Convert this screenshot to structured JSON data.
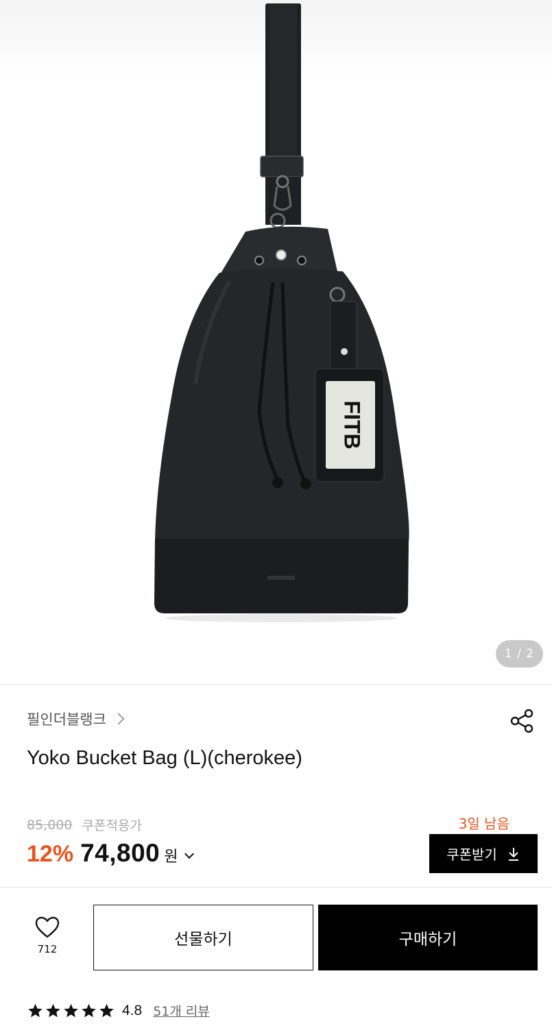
{
  "gallery": {
    "page_indicator": "1 / 2",
    "product_tag_text": "FITB"
  },
  "product": {
    "brand": "필인더블랭크",
    "title": "Yoko Bucket Bag (L)(cherokee)"
  },
  "pricing": {
    "original_price": "85,000",
    "coupon_note": "쿠폰적용가",
    "discount_percent": "12%",
    "sale_price": "74,800",
    "currency_unit": "원",
    "days_left": "3일 남음",
    "accent_color": "#e8531c"
  },
  "coupon": {
    "button_label": "쿠폰받기"
  },
  "actions": {
    "like_count": "712",
    "gift_label": "선물하기",
    "buy_label": "구매하기"
  },
  "rating": {
    "stars": 5,
    "value": "4.8",
    "review_link": "51개 리뷰"
  },
  "icons": [
    "chevron-right-icon",
    "share-icon",
    "download-icon",
    "chevron-down-icon",
    "heart-icon",
    "star-icon"
  ]
}
